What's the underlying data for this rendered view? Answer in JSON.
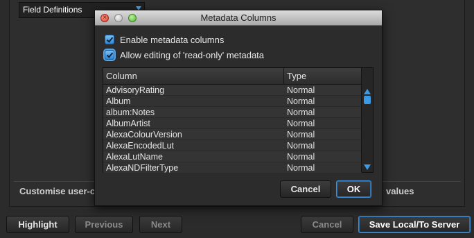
{
  "background": {
    "field_definitions": "Field Definitions",
    "customise_text": "Customise user-c",
    "values_text": "values"
  },
  "bottom_buttons": {
    "highlight": "Highlight",
    "previous": "Previous",
    "next": "Next",
    "cancel": "Cancel",
    "save": "Save Local/To Server"
  },
  "dialog": {
    "title": "Metadata Columns",
    "enable_label": "Enable metadata columns",
    "allow_label": "Allow editing of 'read-only' metadata",
    "table": {
      "headers": [
        "Column",
        "Type"
      ],
      "rows": [
        [
          "AdvisoryRating",
          "Normal"
        ],
        [
          "Album",
          "Normal"
        ],
        [
          "album:Notes",
          "Normal"
        ],
        [
          "AlbumArtist",
          "Normal"
        ],
        [
          "AlexaColourVersion",
          "Normal"
        ],
        [
          "AlexaEncodedLut",
          "Normal"
        ],
        [
          "AlexaLutName",
          "Normal"
        ],
        [
          "AlexaNDFilterType",
          "Normal"
        ]
      ]
    },
    "cancel_label": "Cancel",
    "ok_label": "OK"
  }
}
